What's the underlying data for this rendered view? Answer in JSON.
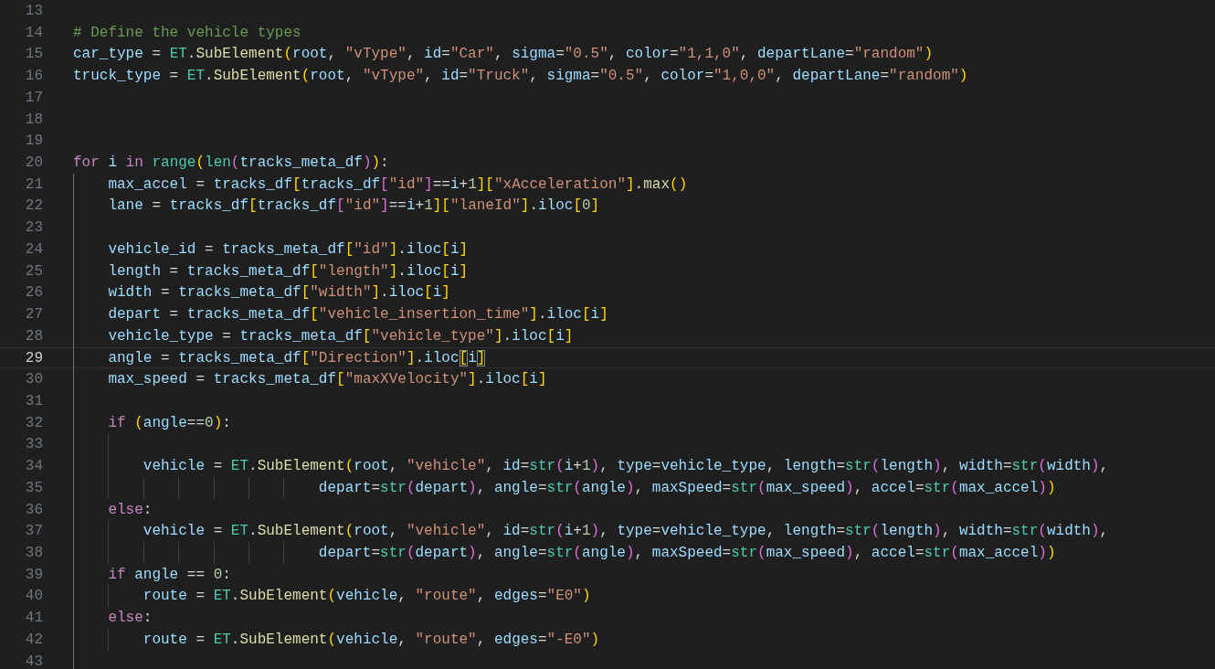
{
  "editor": {
    "lines": [
      {
        "number": "13",
        "current": false
      },
      {
        "number": "14",
        "current": false,
        "tokens": [
          {
            "text": "# Define the vehicle types",
            "kind": "comment"
          }
        ]
      },
      {
        "number": "15",
        "current": false,
        "tokens": [
          {
            "text": "car_type",
            "kind": "variable"
          },
          {
            "text": " = ",
            "kind": "plain"
          },
          {
            "text": "ET",
            "kind": "class"
          },
          {
            "text": ".",
            "kind": "plain"
          },
          {
            "text": "SubElement",
            "kind": "function"
          },
          {
            "text": "(",
            "kind": "bracket1"
          },
          {
            "text": "root",
            "kind": "variable"
          },
          {
            "text": ", ",
            "kind": "plain"
          },
          {
            "text": "\"vType\"",
            "kind": "string"
          },
          {
            "text": ", ",
            "kind": "plain"
          },
          {
            "text": "id",
            "kind": "variable"
          },
          {
            "text": "=",
            "kind": "plain"
          },
          {
            "text": "\"Car\"",
            "kind": "string"
          },
          {
            "text": ", ",
            "kind": "plain"
          },
          {
            "text": "sigma",
            "kind": "variable"
          },
          {
            "text": "=",
            "kind": "plain"
          },
          {
            "text": "\"0.5\"",
            "kind": "string"
          },
          {
            "text": ", ",
            "kind": "plain"
          },
          {
            "text": "color",
            "kind": "variable"
          },
          {
            "text": "=",
            "kind": "plain"
          },
          {
            "text": "\"1,1,0\"",
            "kind": "string"
          },
          {
            "text": ", ",
            "kind": "plain"
          },
          {
            "text": "departLane",
            "kind": "variable"
          },
          {
            "text": "=",
            "kind": "plain"
          },
          {
            "text": "\"random\"",
            "kind": "string"
          },
          {
            "text": ")",
            "kind": "bracket1"
          }
        ]
      },
      {
        "number": "16",
        "current": false,
        "tokens": [
          {
            "text": "truck_type",
            "kind": "variable"
          },
          {
            "text": " = ",
            "kind": "plain"
          },
          {
            "text": "ET",
            "kind": "class"
          },
          {
            "text": ".",
            "kind": "plain"
          },
          {
            "text": "SubElement",
            "kind": "function"
          },
          {
            "text": "(",
            "kind": "bracket1"
          },
          {
            "text": "root",
            "kind": "variable"
          },
          {
            "text": ", ",
            "kind": "plain"
          },
          {
            "text": "\"vType\"",
            "kind": "string"
          },
          {
            "text": ", ",
            "kind": "plain"
          },
          {
            "text": "id",
            "kind": "variable"
          },
          {
            "text": "=",
            "kind": "plain"
          },
          {
            "text": "\"Truck\"",
            "kind": "string"
          },
          {
            "text": ", ",
            "kind": "plain"
          },
          {
            "text": "sigma",
            "kind": "variable"
          },
          {
            "text": "=",
            "kind": "plain"
          },
          {
            "text": "\"0.5\"",
            "kind": "string"
          },
          {
            "text": ", ",
            "kind": "plain"
          },
          {
            "text": "color",
            "kind": "variable"
          },
          {
            "text": "=",
            "kind": "plain"
          },
          {
            "text": "\"1,0,0\"",
            "kind": "string"
          },
          {
            "text": ", ",
            "kind": "plain"
          },
          {
            "text": "departLane",
            "kind": "variable"
          },
          {
            "text": "=",
            "kind": "plain"
          },
          {
            "text": "\"random\"",
            "kind": "string"
          },
          {
            "text": ")",
            "kind": "bracket1"
          }
        ]
      },
      {
        "number": "17",
        "current": false
      },
      {
        "number": "18",
        "current": false
      },
      {
        "number": "19",
        "current": false
      },
      {
        "number": "20",
        "current": false,
        "tokens": [
          {
            "text": "for",
            "kind": "keyword"
          },
          {
            "text": " i",
            "kind": "variable"
          },
          {
            "text": " in",
            "kind": "keyword"
          },
          {
            "text": " range",
            "kind": "class"
          },
          {
            "text": "(",
            "kind": "bracket1"
          },
          {
            "text": "len",
            "kind": "class"
          },
          {
            "text": "(",
            "kind": "bracket2"
          },
          {
            "text": "tracks_meta_df",
            "kind": "variable"
          },
          {
            "text": ")",
            "kind": "bracket2"
          },
          {
            "text": ")",
            "kind": "bracket1"
          },
          {
            "text": ":",
            "kind": "plain"
          }
        ]
      },
      {
        "number": "21",
        "current": false,
        "tokens": [
          {
            "text": "    max_accel",
            "kind": "variable"
          },
          {
            "text": " = ",
            "kind": "plain"
          },
          {
            "text": "tracks_df",
            "kind": "variable"
          },
          {
            "text": "[",
            "kind": "bracket1"
          },
          {
            "text": "tracks_df",
            "kind": "variable"
          },
          {
            "text": "[",
            "kind": "bracket2"
          },
          {
            "text": "\"id\"",
            "kind": "string"
          },
          {
            "text": "]",
            "kind": "bracket2"
          },
          {
            "text": "==",
            "kind": "plain"
          },
          {
            "text": "i",
            "kind": "variable"
          },
          {
            "text": "+",
            "kind": "plain"
          },
          {
            "text": "1",
            "kind": "number"
          },
          {
            "text": "]",
            "kind": "bracket1"
          },
          {
            "text": "[",
            "kind": "bracket1"
          },
          {
            "text": "\"xAcceleration\"",
            "kind": "string"
          },
          {
            "text": "]",
            "kind": "bracket1"
          },
          {
            "text": ".",
            "kind": "plain"
          },
          {
            "text": "max",
            "kind": "function"
          },
          {
            "text": "(",
            "kind": "bracket1"
          },
          {
            "text": ")",
            "kind": "bracket1"
          }
        ]
      },
      {
        "number": "22",
        "current": false,
        "tokens": [
          {
            "text": "    lane",
            "kind": "variable"
          },
          {
            "text": " = ",
            "kind": "plain"
          },
          {
            "text": "tracks_df",
            "kind": "variable"
          },
          {
            "text": "[",
            "kind": "bracket1"
          },
          {
            "text": "tracks_df",
            "kind": "variable"
          },
          {
            "text": "[",
            "kind": "bracket2"
          },
          {
            "text": "\"id\"",
            "kind": "string"
          },
          {
            "text": "]",
            "kind": "bracket2"
          },
          {
            "text": "==",
            "kind": "plain"
          },
          {
            "text": "i",
            "kind": "variable"
          },
          {
            "text": "+",
            "kind": "plain"
          },
          {
            "text": "1",
            "kind": "number"
          },
          {
            "text": "]",
            "kind": "bracket1"
          },
          {
            "text": "[",
            "kind": "bracket1"
          },
          {
            "text": "\"laneId\"",
            "kind": "string"
          },
          {
            "text": "]",
            "kind": "bracket1"
          },
          {
            "text": ".",
            "kind": "plain"
          },
          {
            "text": "iloc",
            "kind": "variable"
          },
          {
            "text": "[",
            "kind": "bracket1"
          },
          {
            "text": "0",
            "kind": "number"
          },
          {
            "text": "]",
            "kind": "bracket1"
          }
        ]
      },
      {
        "number": "23",
        "current": false
      },
      {
        "number": "24",
        "current": false,
        "tokens": [
          {
            "text": "    vehicle_id",
            "kind": "variable"
          },
          {
            "text": " = ",
            "kind": "plain"
          },
          {
            "text": "tracks_meta_df",
            "kind": "variable"
          },
          {
            "text": "[",
            "kind": "bracket1"
          },
          {
            "text": "\"id\"",
            "kind": "string"
          },
          {
            "text": "]",
            "kind": "bracket1"
          },
          {
            "text": ".",
            "kind": "plain"
          },
          {
            "text": "iloc",
            "kind": "variable"
          },
          {
            "text": "[",
            "kind": "bracket1"
          },
          {
            "text": "i",
            "kind": "variable"
          },
          {
            "text": "]",
            "kind": "bracket1"
          }
        ]
      },
      {
        "number": "25",
        "current": false,
        "tokens": [
          {
            "text": "    length",
            "kind": "variable"
          },
          {
            "text": " = ",
            "kind": "plain"
          },
          {
            "text": "tracks_meta_df",
            "kind": "variable"
          },
          {
            "text": "[",
            "kind": "bracket1"
          },
          {
            "text": "\"length\"",
            "kind": "string"
          },
          {
            "text": "]",
            "kind": "bracket1"
          },
          {
            "text": ".",
            "kind": "plain"
          },
          {
            "text": "iloc",
            "kind": "variable"
          },
          {
            "text": "[",
            "kind": "bracket1"
          },
          {
            "text": "i",
            "kind": "variable"
          },
          {
            "text": "]",
            "kind": "bracket1"
          }
        ]
      },
      {
        "number": "26",
        "current": false,
        "tokens": [
          {
            "text": "    width",
            "kind": "variable"
          },
          {
            "text": " = ",
            "kind": "plain"
          },
          {
            "text": "tracks_meta_df",
            "kind": "variable"
          },
          {
            "text": "[",
            "kind": "bracket1"
          },
          {
            "text": "\"width\"",
            "kind": "string"
          },
          {
            "text": "]",
            "kind": "bracket1"
          },
          {
            "text": ".",
            "kind": "plain"
          },
          {
            "text": "iloc",
            "kind": "variable"
          },
          {
            "text": "[",
            "kind": "bracket1"
          },
          {
            "text": "i",
            "kind": "variable"
          },
          {
            "text": "]",
            "kind": "bracket1"
          }
        ]
      },
      {
        "number": "27",
        "current": false,
        "tokens": [
          {
            "text": "    depart",
            "kind": "variable"
          },
          {
            "text": " = ",
            "kind": "plain"
          },
          {
            "text": "tracks_meta_df",
            "kind": "variable"
          },
          {
            "text": "[",
            "kind": "bracket1"
          },
          {
            "text": "\"vehicle_insertion_time\"",
            "kind": "string"
          },
          {
            "text": "]",
            "kind": "bracket1"
          },
          {
            "text": ".",
            "kind": "plain"
          },
          {
            "text": "iloc",
            "kind": "variable"
          },
          {
            "text": "[",
            "kind": "bracket1"
          },
          {
            "text": "i",
            "kind": "variable"
          },
          {
            "text": "]",
            "kind": "bracket1"
          }
        ]
      },
      {
        "number": "28",
        "current": false,
        "tokens": [
          {
            "text": "    vehicle_type",
            "kind": "variable"
          },
          {
            "text": " = ",
            "kind": "plain"
          },
          {
            "text": "tracks_meta_df",
            "kind": "variable"
          },
          {
            "text": "[",
            "kind": "bracket1"
          },
          {
            "text": "\"vehicle_type\"",
            "kind": "string"
          },
          {
            "text": "]",
            "kind": "bracket1"
          },
          {
            "text": ".",
            "kind": "plain"
          },
          {
            "text": "iloc",
            "kind": "variable"
          },
          {
            "text": "[",
            "kind": "bracket1"
          },
          {
            "text": "i",
            "kind": "variable"
          },
          {
            "text": "]",
            "kind": "bracket1"
          }
        ]
      },
      {
        "number": "29",
        "current": true,
        "tokens": [
          {
            "text": "    angle",
            "kind": "variable"
          },
          {
            "text": " = ",
            "kind": "plain"
          },
          {
            "text": "tracks_meta_df",
            "kind": "variable"
          },
          {
            "text": "[",
            "kind": "bracket1"
          },
          {
            "text": "\"Direction\"",
            "kind": "string"
          },
          {
            "text": "]",
            "kind": "bracket1"
          },
          {
            "text": ".",
            "kind": "plain"
          },
          {
            "text": "iloc",
            "kind": "variable"
          },
          {
            "text": "[",
            "kind": "bracket1",
            "matched": true
          },
          {
            "text": "i",
            "kind": "variable"
          },
          {
            "text": "]",
            "kind": "bracket1",
            "matched": true
          }
        ]
      },
      {
        "number": "30",
        "current": false,
        "tokens": [
          {
            "text": "    max_speed",
            "kind": "variable"
          },
          {
            "text": " = ",
            "kind": "plain"
          },
          {
            "text": "tracks_meta_df",
            "kind": "variable"
          },
          {
            "text": "[",
            "kind": "bracket1"
          },
          {
            "text": "\"maxXVelocity\"",
            "kind": "string"
          },
          {
            "text": "]",
            "kind": "bracket1"
          },
          {
            "text": ".",
            "kind": "plain"
          },
          {
            "text": "iloc",
            "kind": "variable"
          },
          {
            "text": "[",
            "kind": "bracket1"
          },
          {
            "text": "i",
            "kind": "variable"
          },
          {
            "text": "]",
            "kind": "bracket1"
          }
        ]
      },
      {
        "number": "31",
        "current": false
      },
      {
        "number": "32",
        "current": false,
        "tokens": [
          {
            "text": "    if",
            "kind": "keyword"
          },
          {
            "text": " (",
            "kind": "bracket1"
          },
          {
            "text": "angle",
            "kind": "variable"
          },
          {
            "text": "==",
            "kind": "plain"
          },
          {
            "text": "0",
            "kind": "number"
          },
          {
            "text": ")",
            "kind": "bracket1"
          },
          {
            "text": ":",
            "kind": "plain"
          }
        ]
      },
      {
        "number": "33",
        "current": false
      },
      {
        "number": "34",
        "current": false,
        "tokens": [
          {
            "text": "        vehicle",
            "kind": "variable"
          },
          {
            "text": " = ",
            "kind": "plain"
          },
          {
            "text": "ET",
            "kind": "class"
          },
          {
            "text": ".",
            "kind": "plain"
          },
          {
            "text": "SubElement",
            "kind": "function"
          },
          {
            "text": "(",
            "kind": "bracket1"
          },
          {
            "text": "root",
            "kind": "variable"
          },
          {
            "text": ", ",
            "kind": "plain"
          },
          {
            "text": "\"vehicle\"",
            "kind": "string"
          },
          {
            "text": ", ",
            "kind": "plain"
          },
          {
            "text": "id",
            "kind": "variable"
          },
          {
            "text": "=",
            "kind": "plain"
          },
          {
            "text": "str",
            "kind": "class"
          },
          {
            "text": "(",
            "kind": "bracket2"
          },
          {
            "text": "i",
            "kind": "variable"
          },
          {
            "text": "+",
            "kind": "plain"
          },
          {
            "text": "1",
            "kind": "number"
          },
          {
            "text": ")",
            "kind": "bracket2"
          },
          {
            "text": ", ",
            "kind": "plain"
          },
          {
            "text": "type",
            "kind": "variable"
          },
          {
            "text": "=",
            "kind": "plain"
          },
          {
            "text": "vehicle_type",
            "kind": "variable"
          },
          {
            "text": ", ",
            "kind": "plain"
          },
          {
            "text": "length",
            "kind": "variable"
          },
          {
            "text": "=",
            "kind": "plain"
          },
          {
            "text": "str",
            "kind": "class"
          },
          {
            "text": "(",
            "kind": "bracket2"
          },
          {
            "text": "length",
            "kind": "variable"
          },
          {
            "text": ")",
            "kind": "bracket2"
          },
          {
            "text": ", ",
            "kind": "plain"
          },
          {
            "text": "width",
            "kind": "variable"
          },
          {
            "text": "=",
            "kind": "plain"
          },
          {
            "text": "str",
            "kind": "class"
          },
          {
            "text": "(",
            "kind": "bracket2"
          },
          {
            "text": "width",
            "kind": "variable"
          },
          {
            "text": ")",
            "kind": "bracket2"
          },
          {
            "text": ",",
            "kind": "plain"
          }
        ]
      },
      {
        "number": "35",
        "current": false,
        "tokens": [
          {
            "text": "                            depart",
            "kind": "variable"
          },
          {
            "text": "=",
            "kind": "plain"
          },
          {
            "text": "str",
            "kind": "class"
          },
          {
            "text": "(",
            "kind": "bracket2"
          },
          {
            "text": "depart",
            "kind": "variable"
          },
          {
            "text": ")",
            "kind": "bracket2"
          },
          {
            "text": ", ",
            "kind": "plain"
          },
          {
            "text": "angle",
            "kind": "variable"
          },
          {
            "text": "=",
            "kind": "plain"
          },
          {
            "text": "str",
            "kind": "class"
          },
          {
            "text": "(",
            "kind": "bracket2"
          },
          {
            "text": "angle",
            "kind": "variable"
          },
          {
            "text": ")",
            "kind": "bracket2"
          },
          {
            "text": ", ",
            "kind": "plain"
          },
          {
            "text": "maxSpeed",
            "kind": "variable"
          },
          {
            "text": "=",
            "kind": "plain"
          },
          {
            "text": "str",
            "kind": "class"
          },
          {
            "text": "(",
            "kind": "bracket2"
          },
          {
            "text": "max_speed",
            "kind": "variable"
          },
          {
            "text": ")",
            "kind": "bracket2"
          },
          {
            "text": ", ",
            "kind": "plain"
          },
          {
            "text": "accel",
            "kind": "variable"
          },
          {
            "text": "=",
            "kind": "plain"
          },
          {
            "text": "str",
            "kind": "class"
          },
          {
            "text": "(",
            "kind": "bracket2"
          },
          {
            "text": "max_accel",
            "kind": "variable"
          },
          {
            "text": ")",
            "kind": "bracket2"
          },
          {
            "text": ")",
            "kind": "bracket1"
          }
        ]
      },
      {
        "number": "36",
        "current": false,
        "tokens": [
          {
            "text": "    else",
            "kind": "keyword"
          },
          {
            "text": ":",
            "kind": "plain"
          }
        ]
      },
      {
        "number": "37",
        "current": false,
        "tokens": [
          {
            "text": "        vehicle",
            "kind": "variable"
          },
          {
            "text": " = ",
            "kind": "plain"
          },
          {
            "text": "ET",
            "kind": "class"
          },
          {
            "text": ".",
            "kind": "plain"
          },
          {
            "text": "SubElement",
            "kind": "function"
          },
          {
            "text": "(",
            "kind": "bracket1"
          },
          {
            "text": "root",
            "kind": "variable"
          },
          {
            "text": ", ",
            "kind": "plain"
          },
          {
            "text": "\"vehicle\"",
            "kind": "string"
          },
          {
            "text": ", ",
            "kind": "plain"
          },
          {
            "text": "id",
            "kind": "variable"
          },
          {
            "text": "=",
            "kind": "plain"
          },
          {
            "text": "str",
            "kind": "class"
          },
          {
            "text": "(",
            "kind": "bracket2"
          },
          {
            "text": "i",
            "kind": "variable"
          },
          {
            "text": "+",
            "kind": "plain"
          },
          {
            "text": "1",
            "kind": "number"
          },
          {
            "text": ")",
            "kind": "bracket2"
          },
          {
            "text": ", ",
            "kind": "plain"
          },
          {
            "text": "type",
            "kind": "variable"
          },
          {
            "text": "=",
            "kind": "plain"
          },
          {
            "text": "vehicle_type",
            "kind": "variable"
          },
          {
            "text": ", ",
            "kind": "plain"
          },
          {
            "text": "length",
            "kind": "variable"
          },
          {
            "text": "=",
            "kind": "plain"
          },
          {
            "text": "str",
            "kind": "class"
          },
          {
            "text": "(",
            "kind": "bracket2"
          },
          {
            "text": "length",
            "kind": "variable"
          },
          {
            "text": ")",
            "kind": "bracket2"
          },
          {
            "text": ", ",
            "kind": "plain"
          },
          {
            "text": "width",
            "kind": "variable"
          },
          {
            "text": "=",
            "kind": "plain"
          },
          {
            "text": "str",
            "kind": "class"
          },
          {
            "text": "(",
            "kind": "bracket2"
          },
          {
            "text": "width",
            "kind": "variable"
          },
          {
            "text": ")",
            "kind": "bracket2"
          },
          {
            "text": ",",
            "kind": "plain"
          }
        ]
      },
      {
        "number": "38",
        "current": false,
        "tokens": [
          {
            "text": "                            depart",
            "kind": "variable"
          },
          {
            "text": "=",
            "kind": "plain"
          },
          {
            "text": "str",
            "kind": "class"
          },
          {
            "text": "(",
            "kind": "bracket2"
          },
          {
            "text": "depart",
            "kind": "variable"
          },
          {
            "text": ")",
            "kind": "bracket2"
          },
          {
            "text": ", ",
            "kind": "plain"
          },
          {
            "text": "angle",
            "kind": "variable"
          },
          {
            "text": "=",
            "kind": "plain"
          },
          {
            "text": "str",
            "kind": "class"
          },
          {
            "text": "(",
            "kind": "bracket2"
          },
          {
            "text": "angle",
            "kind": "variable"
          },
          {
            "text": ")",
            "kind": "bracket2"
          },
          {
            "text": ", ",
            "kind": "plain"
          },
          {
            "text": "maxSpeed",
            "kind": "variable"
          },
          {
            "text": "=",
            "kind": "plain"
          },
          {
            "text": "str",
            "kind": "class"
          },
          {
            "text": "(",
            "kind": "bracket2"
          },
          {
            "text": "max_speed",
            "kind": "variable"
          },
          {
            "text": ")",
            "kind": "bracket2"
          },
          {
            "text": ", ",
            "kind": "plain"
          },
          {
            "text": "accel",
            "kind": "variable"
          },
          {
            "text": "=",
            "kind": "plain"
          },
          {
            "text": "str",
            "kind": "class"
          },
          {
            "text": "(",
            "kind": "bracket2"
          },
          {
            "text": "max_accel",
            "kind": "variable"
          },
          {
            "text": ")",
            "kind": "bracket2"
          },
          {
            "text": ")",
            "kind": "bracket1"
          }
        ]
      },
      {
        "number": "39",
        "current": false,
        "tokens": [
          {
            "text": "    if",
            "kind": "keyword"
          },
          {
            "text": " angle",
            "kind": "variable"
          },
          {
            "text": " == ",
            "kind": "plain"
          },
          {
            "text": "0",
            "kind": "number"
          },
          {
            "text": ":",
            "kind": "plain"
          }
        ]
      },
      {
        "number": "40",
        "current": false,
        "tokens": [
          {
            "text": "        route",
            "kind": "variable"
          },
          {
            "text": " = ",
            "kind": "plain"
          },
          {
            "text": "ET",
            "kind": "class"
          },
          {
            "text": ".",
            "kind": "plain"
          },
          {
            "text": "SubElement",
            "kind": "function"
          },
          {
            "text": "(",
            "kind": "bracket1"
          },
          {
            "text": "vehicle",
            "kind": "variable"
          },
          {
            "text": ", ",
            "kind": "plain"
          },
          {
            "text": "\"route\"",
            "kind": "string"
          },
          {
            "text": ", ",
            "kind": "plain"
          },
          {
            "text": "edges",
            "kind": "variable"
          },
          {
            "text": "=",
            "kind": "plain"
          },
          {
            "text": "\"E0\"",
            "kind": "string"
          },
          {
            "text": ")",
            "kind": "bracket1"
          }
        ]
      },
      {
        "number": "41",
        "current": false,
        "tokens": [
          {
            "text": "    else",
            "kind": "keyword"
          },
          {
            "text": ":",
            "kind": "plain"
          }
        ]
      },
      {
        "number": "42",
        "current": false,
        "tokens": [
          {
            "text": "        route",
            "kind": "variable"
          },
          {
            "text": " = ",
            "kind": "plain"
          },
          {
            "text": "ET",
            "kind": "class"
          },
          {
            "text": ".",
            "kind": "plain"
          },
          {
            "text": "SubElement",
            "kind": "function"
          },
          {
            "text": "(",
            "kind": "bracket1"
          },
          {
            "text": "vehicle",
            "kind": "variable"
          },
          {
            "text": ", ",
            "kind": "plain"
          },
          {
            "text": "\"route\"",
            "kind": "string"
          },
          {
            "text": ", ",
            "kind": "plain"
          },
          {
            "text": "edges",
            "kind": "variable"
          },
          {
            "text": "=",
            "kind": "plain"
          },
          {
            "text": "\"-E0\"",
            "kind": "string"
          },
          {
            "text": ")",
            "kind": "bracket1"
          }
        ]
      },
      {
        "number": "43",
        "current": false
      }
    ]
  }
}
